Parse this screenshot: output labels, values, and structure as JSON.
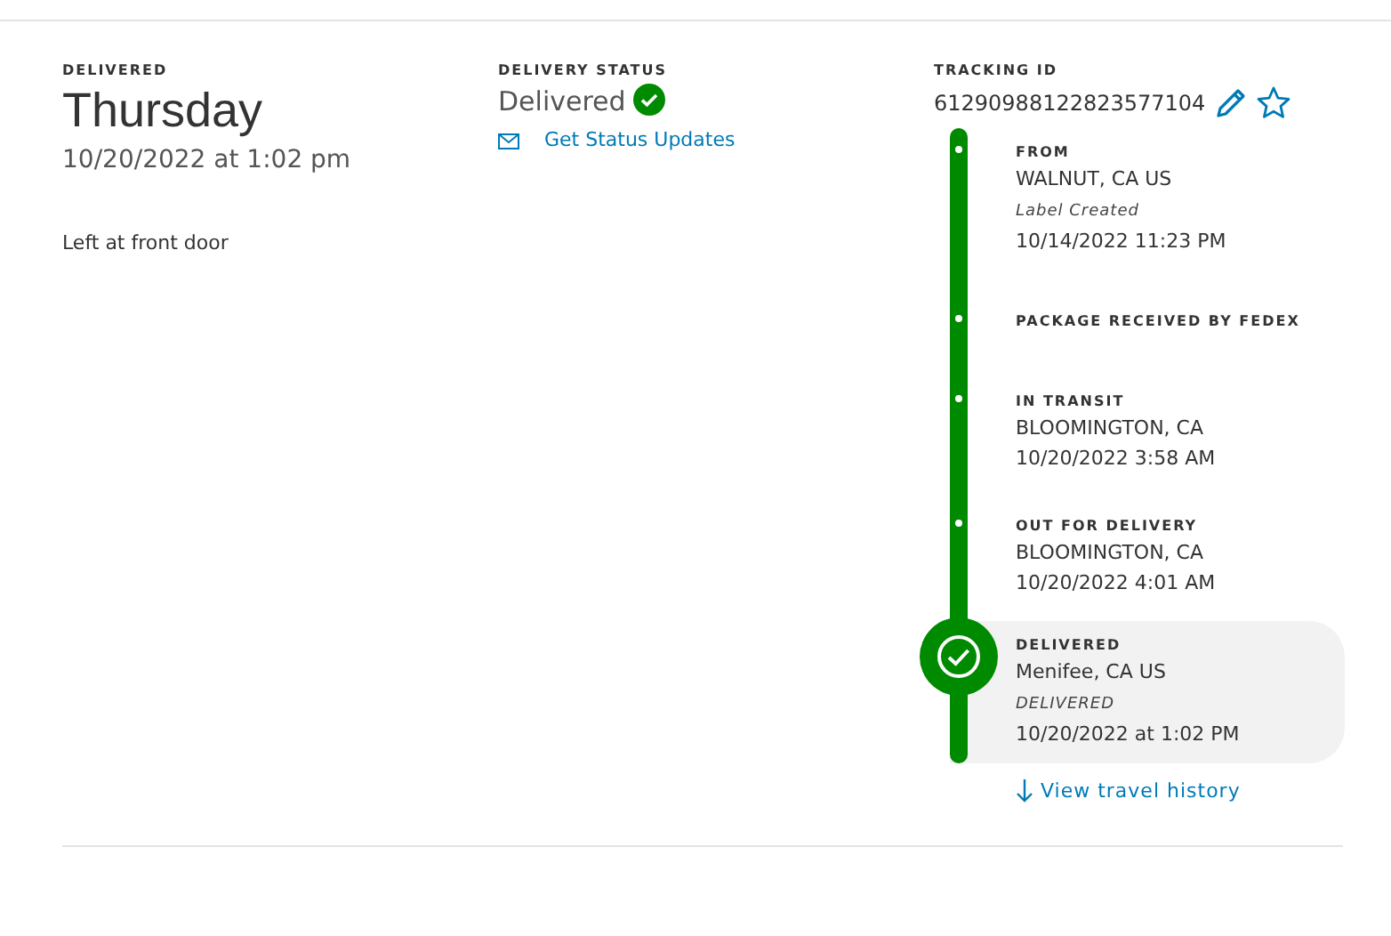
{
  "delivered": {
    "label": "DELIVERED",
    "day": "Thursday",
    "datetime": "10/20/2022 at 1:02 pm",
    "note": "Left at front door"
  },
  "delivery_status": {
    "label": "DELIVERY STATUS",
    "status": "Delivered",
    "delivered": true,
    "updates_link": "Get Status Updates"
  },
  "tracking": {
    "label": "TRACKING ID",
    "id": "61290988122823577104",
    "starred": false
  },
  "timeline": [
    {
      "title": "FROM",
      "location": "WALNUT, CA US",
      "note": "Label Created",
      "time": "10/14/2022 11:23 PM",
      "current": false
    },
    {
      "title": "PACKAGE RECEIVED BY FEDEX",
      "current": false
    },
    {
      "title": "IN TRANSIT",
      "location": "BLOOMINGTON, CA",
      "time": "10/20/2022 3:58 AM",
      "current": false
    },
    {
      "title": "OUT FOR DELIVERY",
      "location": "BLOOMINGTON, CA",
      "time": "10/20/2022 4:01 AM",
      "current": false
    },
    {
      "title": "DELIVERED",
      "location": "Menifee, CA US",
      "note": "DELIVERED",
      "time": "10/20/2022 at 1:02 PM",
      "current": true
    }
  ],
  "travel_history_link": "View travel history"
}
